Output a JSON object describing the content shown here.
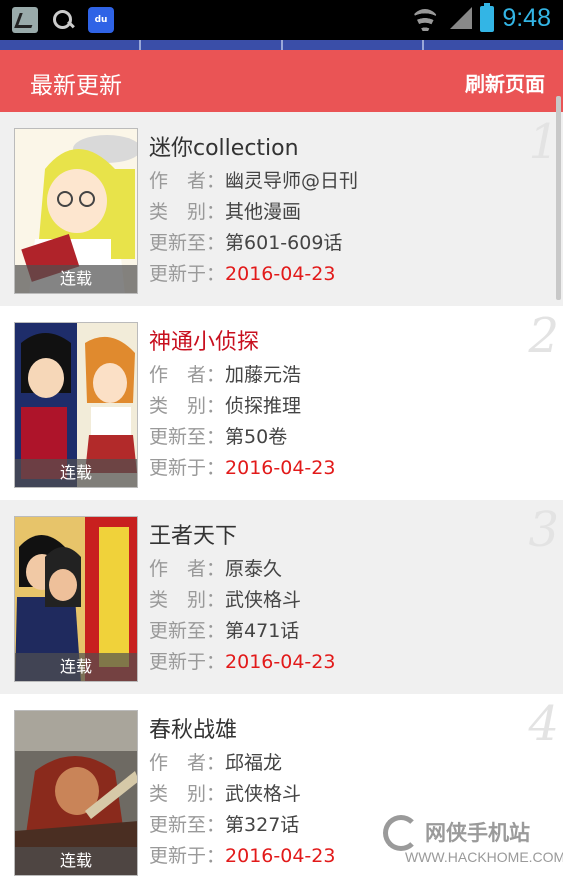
{
  "status_bar": {
    "time": "9:48",
    "baidu_badge": "du"
  },
  "header": {
    "title": "最新更新",
    "refresh_label": "刷新页面"
  },
  "labels": {
    "author": "作　者：",
    "category": "类　别：",
    "updated_to": "更新至：",
    "updated_on": "更新于：",
    "serial": "连载"
  },
  "items": [
    {
      "rank": "1",
      "title": "迷你collection",
      "title_red": false,
      "author": "幽灵导师@日刊",
      "category": "其他漫画",
      "updated_to": "第601-609话",
      "updated_on": "2016-04-23"
    },
    {
      "rank": "2",
      "title": "神通小侦探",
      "title_red": true,
      "author": "加藤元浩",
      "category": "侦探推理",
      "updated_to": "第50卷",
      "updated_on": "2016-04-23"
    },
    {
      "rank": "3",
      "title": "王者天下",
      "title_red": false,
      "author": "原泰久",
      "category": "武侠格斗",
      "updated_to": "第471话",
      "updated_on": "2016-04-23"
    },
    {
      "rank": "4",
      "title": "春秋战雄",
      "title_red": false,
      "author": "邱福龙",
      "category": "武侠格斗",
      "updated_to": "第327话",
      "updated_on": "2016-04-23"
    }
  ],
  "watermark": {
    "cn": "网侠手机站",
    "en": "WWW.HACKHOME.COM"
  }
}
